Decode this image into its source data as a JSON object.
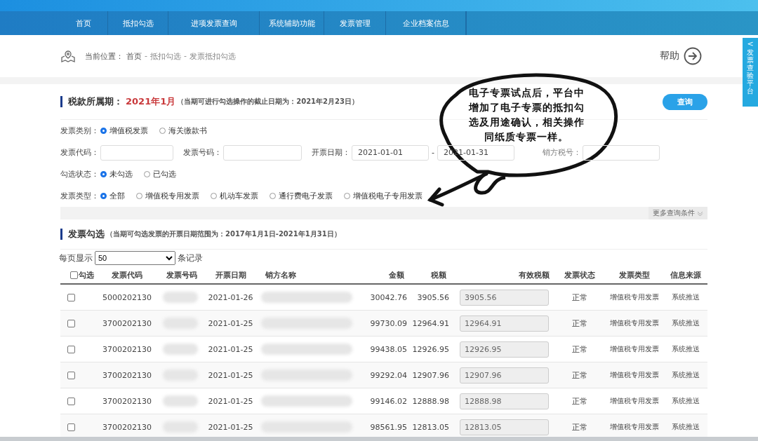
{
  "nav": [
    {
      "label": "首页"
    },
    {
      "label": "抵扣勾选"
    },
    {
      "label": "进项发票查询"
    },
    {
      "label": "系统辅助功能"
    },
    {
      "label": "发票管理"
    },
    {
      "label": "企业档案信息"
    }
  ],
  "breadcrumb": {
    "label": "当前位置：",
    "items": [
      "首页",
      "抵扣勾选",
      "发票抵扣勾选"
    ],
    "separator": "-"
  },
  "help": {
    "label": "帮助"
  },
  "side_tab": {
    "arrow": "<",
    "label": "发票查验平台"
  },
  "period": {
    "label": "税款所属期：",
    "value": "2021年1月",
    "note": "（当期可进行勾选操作的截止日期为：2021年2月23日）"
  },
  "query_button": "查询",
  "filters": {
    "category": {
      "label": "发票类别：",
      "options": [
        {
          "label": "增值税发票",
          "selected": true
        },
        {
          "label": "海关缴款书",
          "selected": false
        }
      ]
    },
    "code": {
      "label": "发票代码："
    },
    "number": {
      "label": "发票号码："
    },
    "date": {
      "label": "开票日期：",
      "from": "2021-01-01",
      "separator": "-",
      "to": "2021-01-31"
    },
    "seller_tax_id": {
      "label": "销方税号："
    },
    "check_status": {
      "label": "勾选状态：",
      "options": [
        {
          "label": "未勾选",
          "selected": true
        },
        {
          "label": "已勾选",
          "selected": false
        }
      ]
    },
    "invoice_type": {
      "label": "发票类型：",
      "options": [
        {
          "label": "全部",
          "selected": true
        },
        {
          "label": "增值税专用发票",
          "selected": false
        },
        {
          "label": "机动车发票",
          "selected": false
        },
        {
          "label": "通行费电子发票",
          "selected": false
        },
        {
          "label": "增值税电子专用发票",
          "selected": false
        }
      ]
    },
    "more": "更多查询条件"
  },
  "section": {
    "title": "发票勾选",
    "note": "（当期可勾选发票的开票日期范围为：2017年1月1日-2021年1月31日）"
  },
  "page_size": {
    "label": "每页显示",
    "value": "50",
    "suffix": "条记录"
  },
  "table": {
    "select_all": {
      "label": "勾选",
      "checked": false
    },
    "columns": [
      "发票代码",
      "发票号码",
      "开票日期",
      "销方名称",
      "金额",
      "税额",
      "有效税额",
      "发票状态",
      "发票类型",
      "信息来源"
    ],
    "rows": [
      {
        "checked": false,
        "code": "5000202130",
        "date": "2021-01-26",
        "amount": "30042.76",
        "tax": "3905.56",
        "effective_tax": "3905.56",
        "status": "正常",
        "type": "增值税专用发票",
        "source": "系统推送"
      },
      {
        "checked": false,
        "code": "3700202130",
        "date": "2021-01-25",
        "amount": "99730.09",
        "tax": "12964.91",
        "effective_tax": "12964.91",
        "status": "正常",
        "type": "增值税专用发票",
        "source": "系统推送"
      },
      {
        "checked": false,
        "code": "3700202130",
        "date": "2021-01-25",
        "amount": "99438.05",
        "tax": "12926.95",
        "effective_tax": "12926.95",
        "status": "正常",
        "type": "增值税专用发票",
        "source": "系统推送"
      },
      {
        "checked": false,
        "code": "3700202130",
        "date": "2021-01-25",
        "amount": "99292.04",
        "tax": "12907.96",
        "effective_tax": "12907.96",
        "status": "正常",
        "type": "增值税专用发票",
        "source": "系统推送"
      },
      {
        "checked": false,
        "code": "3700202130",
        "date": "2021-01-25",
        "amount": "99146.02",
        "tax": "12888.98",
        "effective_tax": "12888.98",
        "status": "正常",
        "type": "增值税专用发票",
        "source": "系统推送"
      },
      {
        "checked": false,
        "code": "3700202130",
        "date": "2021-01-25",
        "amount": "98561.95",
        "tax": "12813.05",
        "effective_tax": "12813.05",
        "status": "正常",
        "type": "增值税专用发票",
        "source": "系统推送"
      }
    ]
  },
  "annotation": {
    "lines": [
      "电子专票试点后，平台中",
      "增加了电子专票的抵扣勾",
      "选及用途确认，相关操作",
      "同纸质专票一样。"
    ]
  }
}
